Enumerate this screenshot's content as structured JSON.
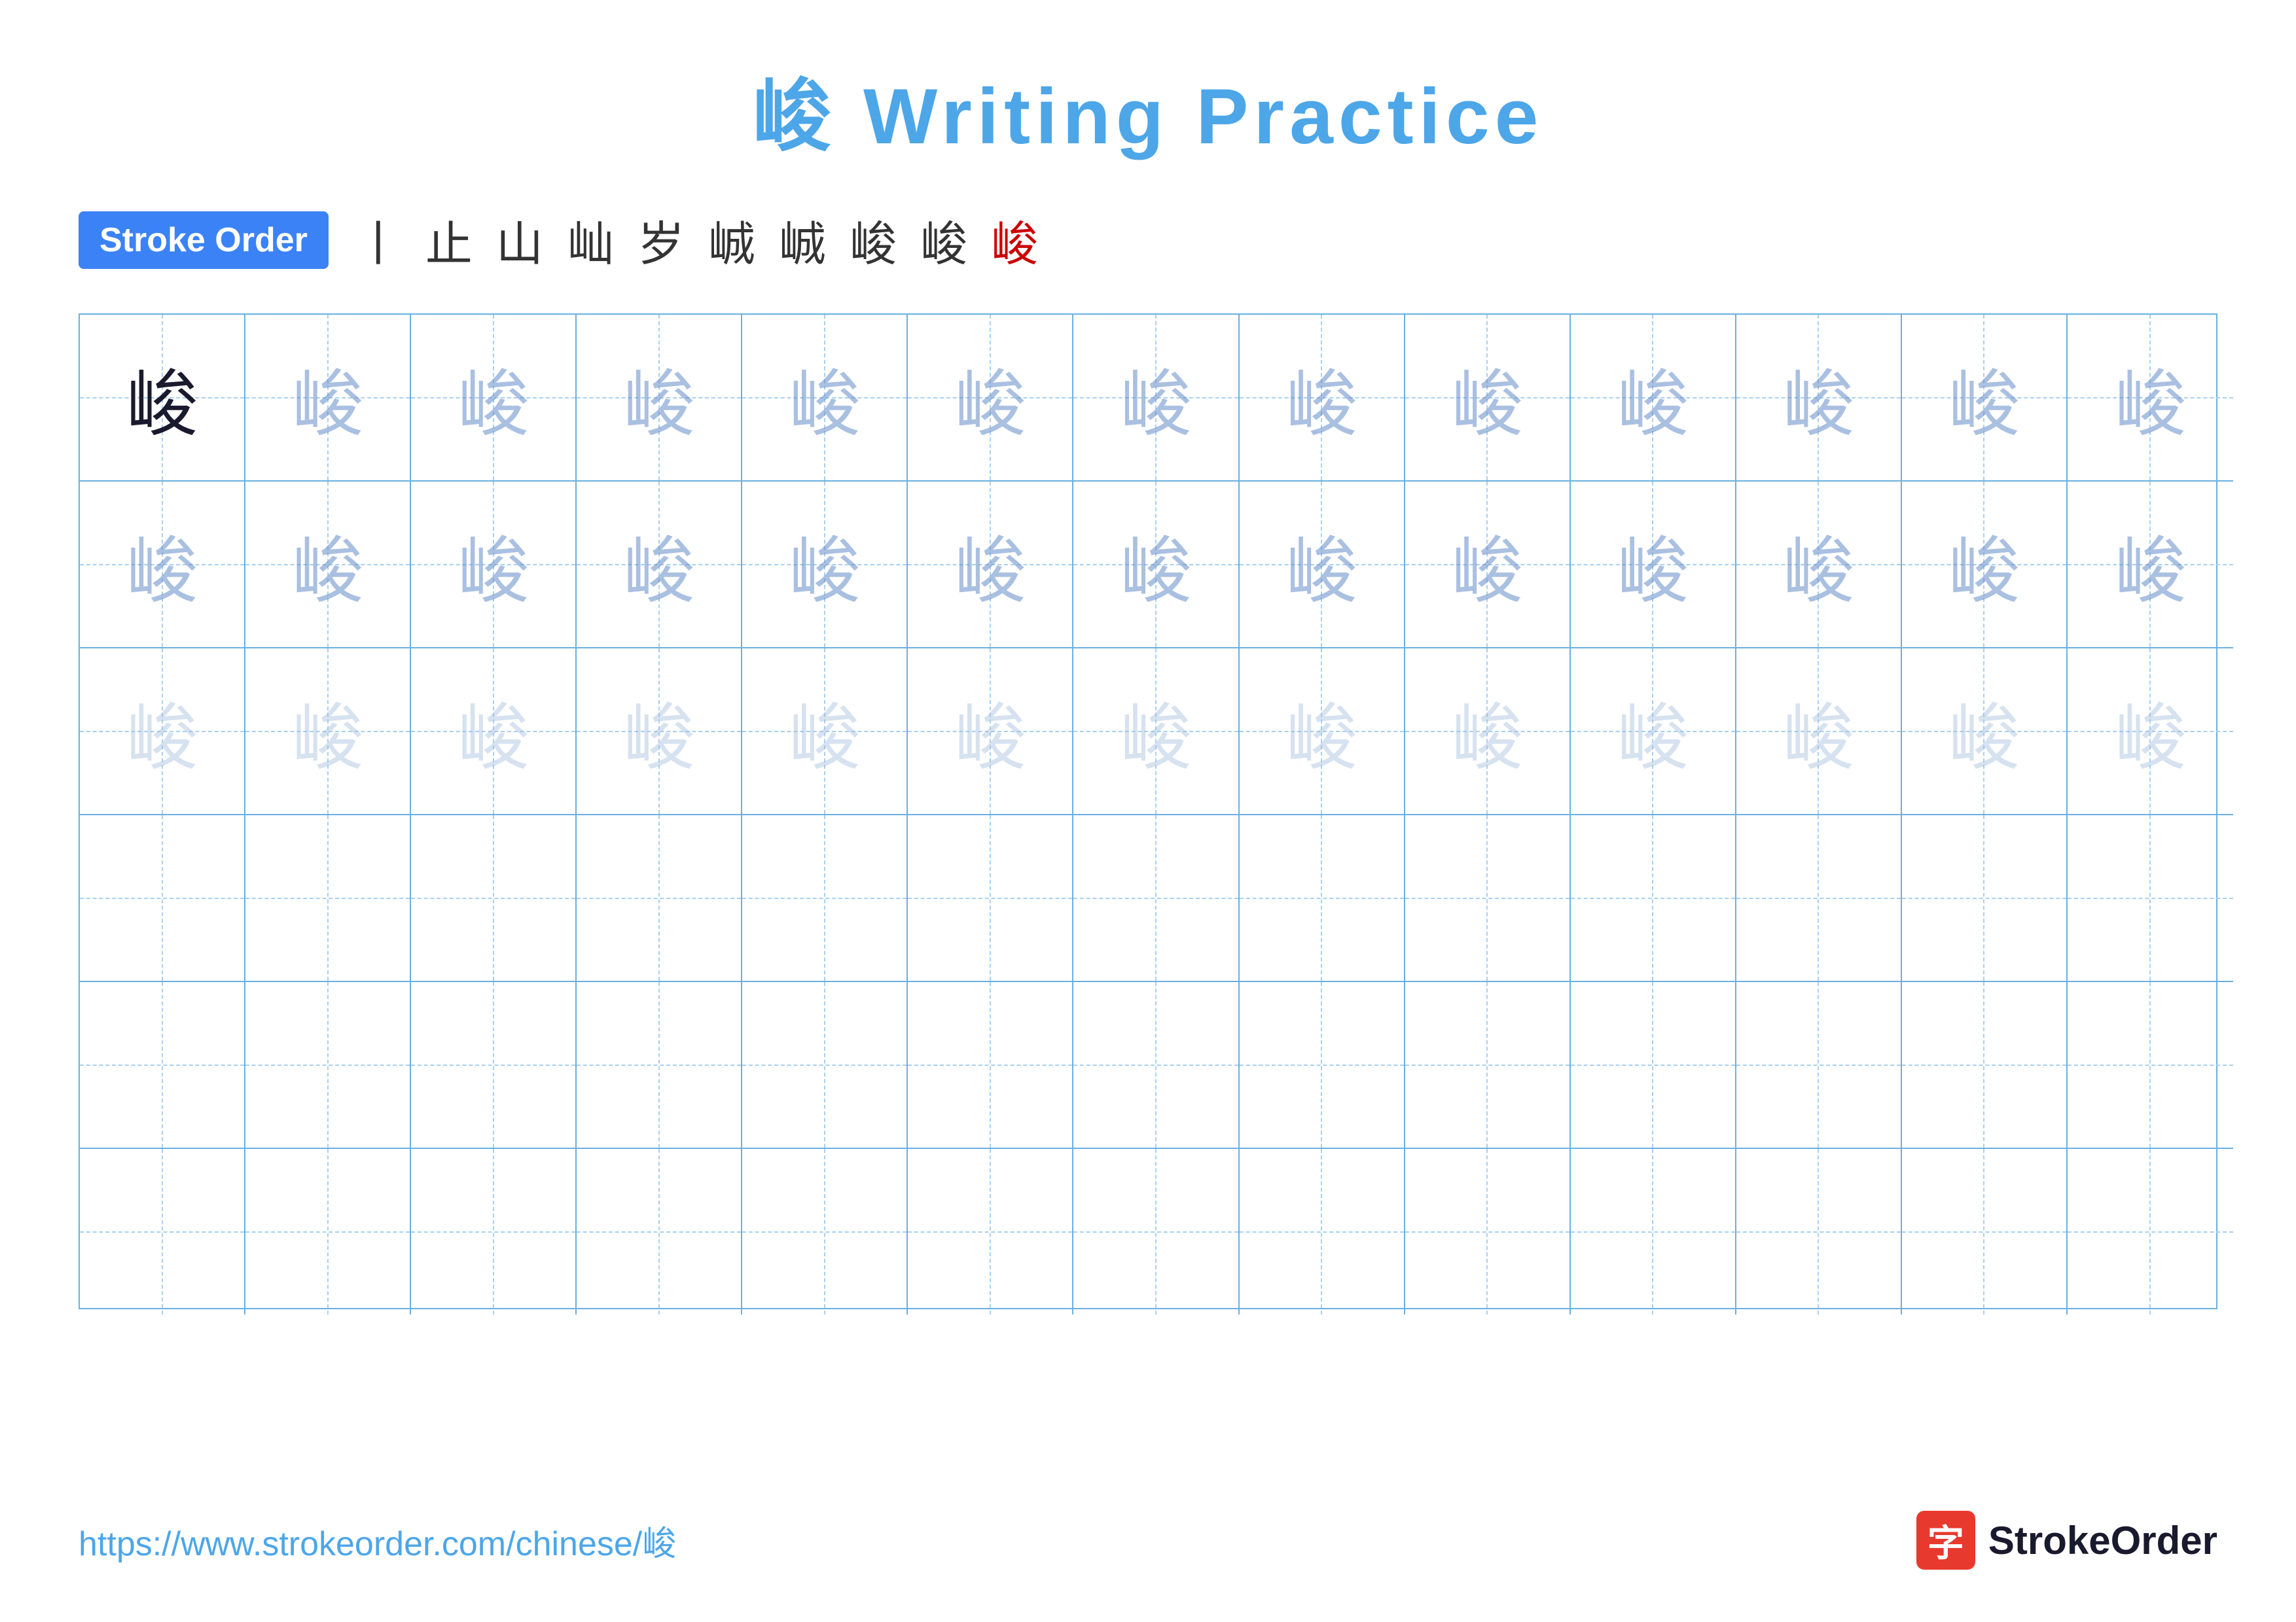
{
  "title": {
    "char": "峻",
    "text": " Writing Practice"
  },
  "stroke_order": {
    "badge_label": "Stroke Order",
    "steps": [
      "丨",
      "止",
      "山",
      "山↙",
      "屾",
      "峸",
      "峻₁",
      "峻₂",
      "峻₃",
      "峻"
    ]
  },
  "grid": {
    "rows": 6,
    "cols": 13,
    "char": "峻",
    "row_types": [
      "solid-then-faint1",
      "faint1",
      "faint2",
      "empty",
      "empty",
      "empty"
    ]
  },
  "footer": {
    "url": "https://www.strokeorder.com/chinese/峻",
    "logo_char": "字",
    "logo_text": "StrokeOrder"
  }
}
